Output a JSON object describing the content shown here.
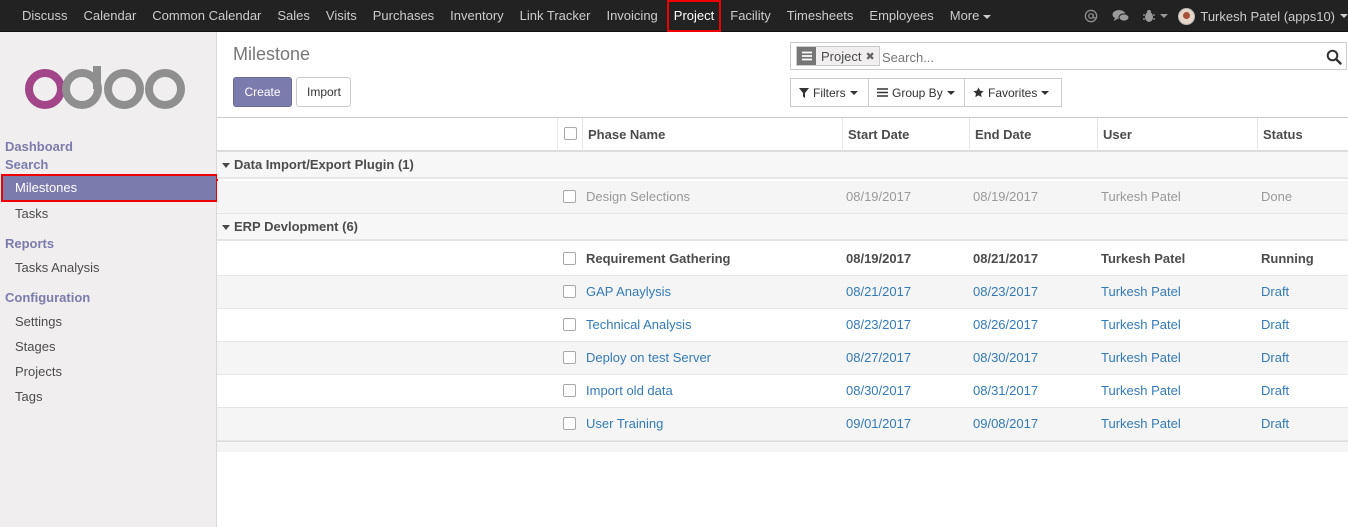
{
  "topbar": {
    "menu": [
      {
        "label": "Discuss",
        "name": "menu-discuss"
      },
      {
        "label": "Calendar",
        "name": "menu-calendar"
      },
      {
        "label": "Common Calendar",
        "name": "menu-common-calendar"
      },
      {
        "label": "Sales",
        "name": "menu-sales"
      },
      {
        "label": "Visits",
        "name": "menu-visits"
      },
      {
        "label": "Purchases",
        "name": "menu-purchases"
      },
      {
        "label": "Inventory",
        "name": "menu-inventory"
      },
      {
        "label": "Link Tracker",
        "name": "menu-link-tracker"
      },
      {
        "label": "Invoicing",
        "name": "menu-invoicing"
      },
      {
        "label": "Project",
        "name": "menu-project",
        "active": true
      },
      {
        "label": "Facility",
        "name": "menu-facility"
      },
      {
        "label": "Timesheets",
        "name": "menu-timesheets"
      },
      {
        "label": "Employees",
        "name": "menu-employees"
      }
    ],
    "more_label": "More",
    "icons": [
      "at-icon",
      "chat-icon",
      "bug-icon"
    ],
    "user_name": "Turkesh Patel (apps10)"
  },
  "sidebar": {
    "sections": [
      {
        "key": "dashboard",
        "label": "Dashboard"
      },
      {
        "key": "search",
        "label": "Search"
      },
      {
        "key": "reports",
        "label": "Reports"
      },
      {
        "key": "configuration",
        "label": "Configuration"
      }
    ],
    "search_items": [
      "Milestones",
      "Tasks"
    ],
    "report_items": [
      "Tasks Analysis"
    ],
    "configuration_items": [
      "Settings",
      "Stages",
      "Projects",
      "Tags"
    ],
    "active_item": "Milestones"
  },
  "control_panel": {
    "title": "Milestone",
    "create_label": "Create",
    "import_label": "Import",
    "search": {
      "facet_label": "Project",
      "placeholder": "Search..."
    },
    "filters_label": "Filters",
    "group_by_label": "Group By",
    "favorites_label": "Favorites"
  },
  "table": {
    "columns": [
      "Phase Name",
      "Start Date",
      "End Date",
      "User",
      "Status"
    ],
    "groups": [
      {
        "label": "Data Import/Export Plugin (1)",
        "rows": [
          {
            "phase": "Design Selections",
            "start": "08/19/2017",
            "end": "08/19/2017",
            "user": "Turkesh Patel",
            "status": "Done"
          }
        ]
      },
      {
        "label": "ERP Devlopment (6)",
        "rows": [
          {
            "phase": "Requirement Gathering",
            "start": "08/19/2017",
            "end": "08/21/2017",
            "user": "Turkesh Patel",
            "status": "Running"
          },
          {
            "phase": "GAP Anaylysis",
            "start": "08/21/2017",
            "end": "08/23/2017",
            "user": "Turkesh Patel",
            "status": "Draft"
          },
          {
            "phase": "Technical Analysis",
            "start": "08/23/2017",
            "end": "08/26/2017",
            "user": "Turkesh Patel",
            "status": "Draft"
          },
          {
            "phase": "Deploy on test Server",
            "start": "08/27/2017",
            "end": "08/30/2017",
            "user": "Turkesh Patel",
            "status": "Draft"
          },
          {
            "phase": "Import old data",
            "start": "08/30/2017",
            "end": "08/31/2017",
            "user": "Turkesh Patel",
            "status": "Draft"
          },
          {
            "phase": "User Training",
            "start": "09/01/2017",
            "end": "09/08/2017",
            "user": "Turkesh Patel",
            "status": "Draft"
          }
        ]
      }
    ]
  },
  "colors": {
    "brand": "#7c7bad",
    "topbar": "#222222",
    "link": "#337ab7",
    "highlight": "#ee0000"
  }
}
